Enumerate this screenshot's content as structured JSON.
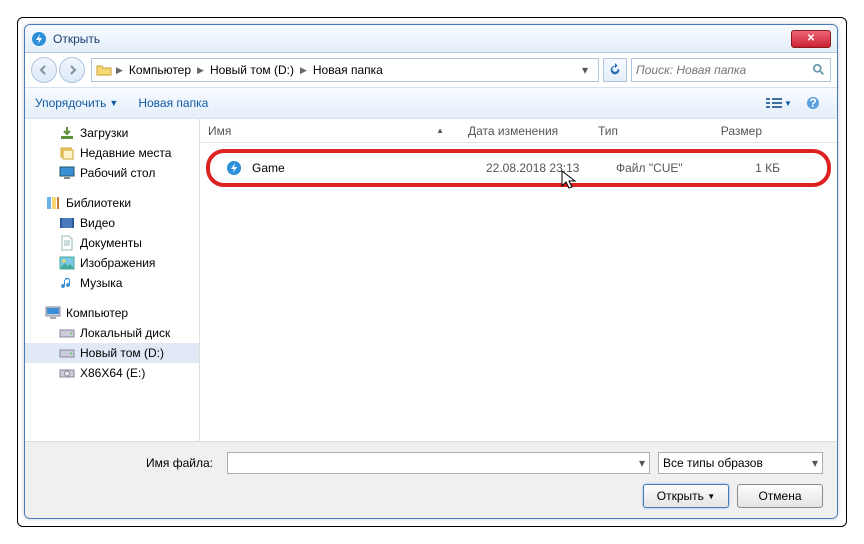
{
  "title": "Открыть",
  "breadcrumb": {
    "root": "Компьютер",
    "drive": "Новый том (D:)",
    "folder": "Новая папка"
  },
  "search": {
    "placeholder": "Поиск: Новая папка"
  },
  "toolbar": {
    "organize": "Упорядочить",
    "newfolder": "Новая папка"
  },
  "sidebar": {
    "favs": [
      {
        "label": "Загрузки",
        "icon": "download"
      },
      {
        "label": "Недавние места",
        "icon": "recent"
      },
      {
        "label": "Рабочий стол",
        "icon": "desktop"
      }
    ],
    "libs_title": "Библиотеки",
    "libs": [
      {
        "label": "Видео",
        "icon": "video"
      },
      {
        "label": "Документы",
        "icon": "doc"
      },
      {
        "label": "Изображения",
        "icon": "image"
      },
      {
        "label": "Музыка",
        "icon": "music"
      }
    ],
    "computer_title": "Компьютер",
    "drives": [
      {
        "label": "Локальный диск",
        "icon": "hdd"
      },
      {
        "label": "Новый том (D:)",
        "icon": "hdd",
        "selected": true
      },
      {
        "label": "X86X64 (E:)",
        "icon": "cd"
      }
    ]
  },
  "columns": {
    "name": "Имя",
    "date": "Дата изменения",
    "type": "Тип",
    "size": "Размер"
  },
  "files": [
    {
      "name": "Game",
      "date": "22.08.2018 23:13",
      "type": "Файл \"CUE\"",
      "size": "1 КБ"
    }
  ],
  "bottom": {
    "filename_label": "Имя файла:",
    "filename_value": "",
    "filter": "Все типы образов",
    "open": "Открыть",
    "cancel": "Отмена"
  }
}
